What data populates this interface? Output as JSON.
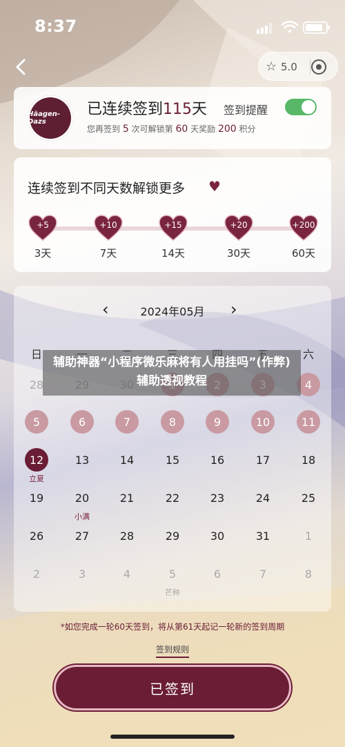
{
  "status_bar": {
    "time": "8:37"
  },
  "header": {
    "score": "5.0"
  },
  "profile": {
    "logo_text": "Häagen-Dazs",
    "streak_prefix": "已连续签到",
    "streak_days": "115",
    "streak_suffix": "天",
    "sub_1": "您再签到",
    "sub_days": "5",
    "sub_2": "次可解锁第",
    "sub_milestone": "60",
    "sub_3": "天奖励",
    "sub_points": "200",
    "sub_4": "积分",
    "remind_label": "签到提醒",
    "remind_on": true
  },
  "milestones": {
    "title": "连续签到不同天数解锁更多",
    "items": [
      {
        "bonus": "+5",
        "label": "3天"
      },
      {
        "bonus": "+10",
        "label": "7天"
      },
      {
        "bonus": "+15",
        "label": "14天"
      },
      {
        "bonus": "+20",
        "label": "30天"
      },
      {
        "bonus": "+200",
        "label": "60天"
      }
    ]
  },
  "calendar": {
    "month": "2024年05月",
    "weekdays": [
      "日",
      "一",
      "二",
      "三",
      "四",
      "五",
      "六"
    ],
    "rows": [
      [
        {
          "d": "28",
          "s": "faded"
        },
        {
          "d": "29",
          "s": "faded"
        },
        {
          "d": "30",
          "s": "faded"
        },
        {
          "d": "1",
          "s": "signed"
        },
        {
          "d": "2",
          "s": "signed"
        },
        {
          "d": "3",
          "s": "signed"
        },
        {
          "d": "4",
          "s": "signed"
        }
      ],
      [
        {
          "d": "5",
          "s": "signed"
        },
        {
          "d": "6",
          "s": "signed"
        },
        {
          "d": "7",
          "s": "signed"
        },
        {
          "d": "8",
          "s": "signed"
        },
        {
          "d": "9",
          "s": "signed"
        },
        {
          "d": "10",
          "s": "signed"
        },
        {
          "d": "11",
          "s": "signed"
        }
      ],
      [
        {
          "d": "12",
          "s": "today",
          "l": "立夏"
        },
        {
          "d": "13",
          "s": ""
        },
        {
          "d": "14",
          "s": ""
        },
        {
          "d": "15",
          "s": ""
        },
        {
          "d": "16",
          "s": ""
        },
        {
          "d": "17",
          "s": ""
        },
        {
          "d": "18",
          "s": ""
        }
      ],
      [
        {
          "d": "19",
          "s": ""
        },
        {
          "d": "20",
          "s": "",
          "l": "小满"
        },
        {
          "d": "21",
          "s": ""
        },
        {
          "d": "22",
          "s": ""
        },
        {
          "d": "23",
          "s": ""
        },
        {
          "d": "24",
          "s": ""
        },
        {
          "d": "25",
          "s": ""
        }
      ],
      [
        {
          "d": "26",
          "s": ""
        },
        {
          "d": "27",
          "s": ""
        },
        {
          "d": "28",
          "s": ""
        },
        {
          "d": "29",
          "s": ""
        },
        {
          "d": "30",
          "s": ""
        },
        {
          "d": "31",
          "s": ""
        },
        {
          "d": "1",
          "s": "faded"
        }
      ],
      [
        {
          "d": "2",
          "s": "faded"
        },
        {
          "d": "3",
          "s": "faded"
        },
        {
          "d": "4",
          "s": "faded"
        },
        {
          "d": "5",
          "s": "faded",
          "l": "芒种"
        },
        {
          "d": "6",
          "s": "faded"
        },
        {
          "d": "7",
          "s": "faded"
        },
        {
          "d": "8",
          "s": "faded"
        }
      ]
    ]
  },
  "overlay_text": "辅助神器“小程序微乐麻将有人用挂吗”(作弊)辅助透视教程",
  "footer": {
    "note": "*如您完成一轮60天签到，将从第61天起记一轮新的签到周期",
    "rules_link": "签到规则",
    "signed_button": "已签到"
  },
  "colors": {
    "brand": "#6a1d35",
    "signed_day": "#c99aa2",
    "toggle_on": "#58b868"
  }
}
